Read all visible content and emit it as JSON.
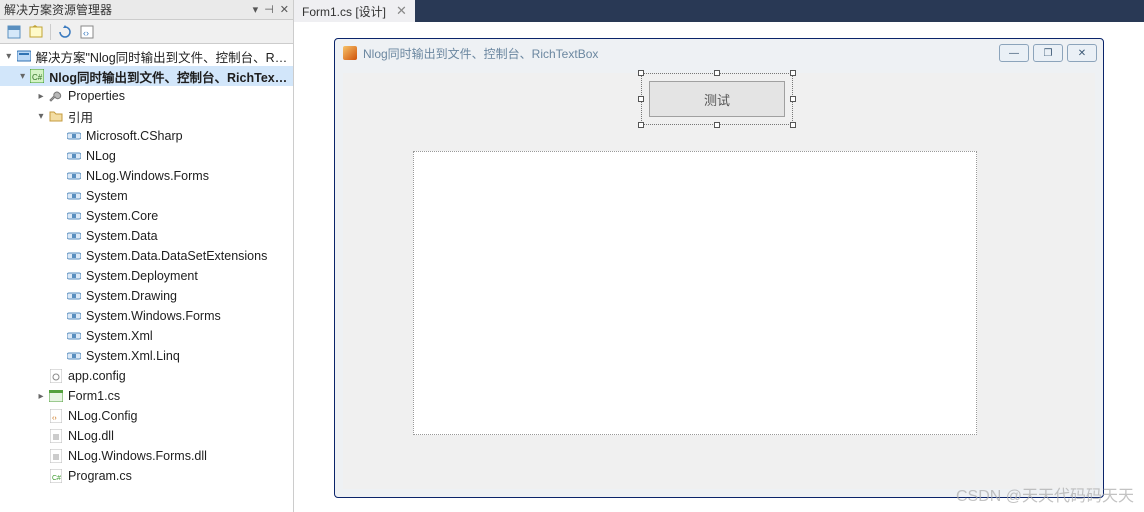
{
  "panel": {
    "title": "解决方案资源管理器",
    "pin_glyph": "⊣",
    "close_glyph": "✕",
    "dropdown_glyph": "▾"
  },
  "tree": {
    "solution_label": "解决方案\"Nlog同时输出到文件、控制台、RichT",
    "project_label": "Nlog同时输出到文件、控制台、RichTextBox",
    "properties_label": "Properties",
    "references_label": "引用",
    "refs": [
      "Microsoft.CSharp",
      "NLog",
      "NLog.Windows.Forms",
      "System",
      "System.Core",
      "System.Data",
      "System.Data.DataSetExtensions",
      "System.Deployment",
      "System.Drawing",
      "System.Windows.Forms",
      "System.Xml",
      "System.Xml.Linq"
    ],
    "files": {
      "appconfig": "app.config",
      "form1": "Form1.cs",
      "nlogcfg": "NLog.Config",
      "nlogdll": "NLog.dll",
      "nlogwfdll": "NLog.Windows.Forms.dll",
      "program": "Program.cs"
    }
  },
  "tab": {
    "label": "Form1.cs [设计]",
    "close_glyph": "✕"
  },
  "form": {
    "title": "Nlog同时输出到文件、控制台、RichTextBox",
    "min": "—",
    "max": "❐",
    "close": "✕",
    "button_label": "测试"
  },
  "watermark": "CSDN @天天代码码天天"
}
